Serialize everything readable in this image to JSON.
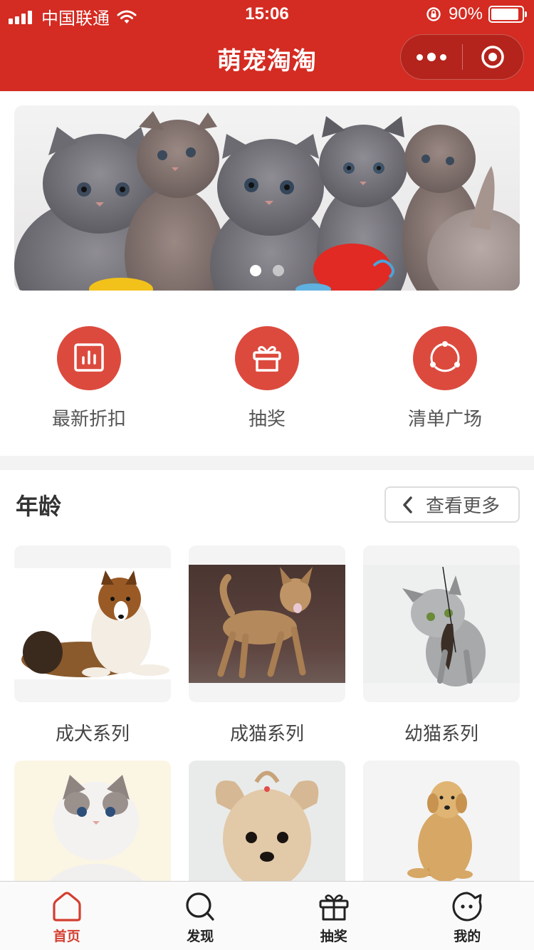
{
  "status_bar": {
    "carrier": "中国联通",
    "time": "15:06",
    "battery_text": "90%",
    "battery_level": 0.9
  },
  "nav": {
    "title": "萌宠淘淘",
    "more_icon": "more-dots-icon",
    "close_icon": "target-circle-icon"
  },
  "banner": {
    "description_icon": "banner-kittens-image",
    "page_count": 2,
    "active_index": 0
  },
  "entries": [
    {
      "label": "最新折扣",
      "icon": "chart-bars-icon"
    },
    {
      "label": "抽奖",
      "icon": "gift-icon"
    },
    {
      "label": "清单广场",
      "icon": "circle-dots-icon"
    }
  ],
  "section": {
    "title": "年龄",
    "more_label": "查看更多"
  },
  "cards": [
    {
      "name": "成犬系列",
      "icon": "collie-dog-image"
    },
    {
      "name": "成猫系列",
      "icon": "abyssinian-cat-image"
    },
    {
      "name": "幼猫系列",
      "icon": "tabby-kitten-image"
    },
    {
      "name": "",
      "icon": "ragdoll-cat-image"
    },
    {
      "name": "",
      "icon": "yorkie-dog-image"
    },
    {
      "name": "",
      "icon": "golden-retriever-image"
    }
  ],
  "tabbar": [
    {
      "label": "首页",
      "icon": "home-icon",
      "active": true
    },
    {
      "label": "发现",
      "icon": "discover-icon",
      "active": false
    },
    {
      "label": "抽奖",
      "icon": "gift-icon",
      "active": false
    },
    {
      "label": "我的",
      "icon": "profile-face-icon",
      "active": false
    }
  ],
  "colors": {
    "brand_red": "#d42b22",
    "entry_circle": "#dc4a3e",
    "tab_active": "#d43e30"
  }
}
